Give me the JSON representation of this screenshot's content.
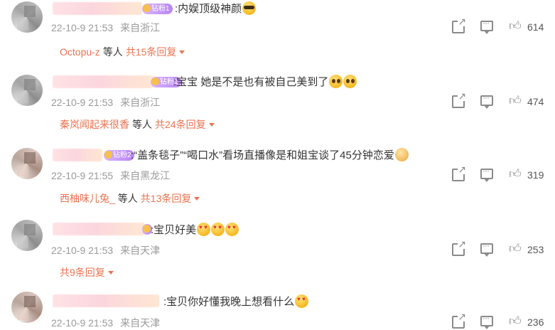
{
  "colors": {
    "accent": "#eb7350",
    "meta": "#9a9a9a",
    "icon": "#8a8a8a"
  },
  "comments": [
    {
      "badge": "钻粉1",
      "text": ":内娱顶级神颜",
      "emojis": [
        "cool-face-emoji"
      ],
      "date": "22-10-9 21:53",
      "location": "来自浙江",
      "likes": "614",
      "reply_name": "Octopu-z",
      "reply_mid": "等人",
      "reply_count": "共15条回复"
    },
    {
      "badge": "钻粉1",
      "text": ":宝宝 她是不是也有被自己美到了",
      "emojis": [
        "pleading-face-emoji",
        "pleading-face-emoji"
      ],
      "date": "22-10-9 21:53",
      "location": "来自浙江",
      "likes": "474",
      "reply_name": "秦岚闻起来很香",
      "reply_mid": "等人",
      "reply_count": "共24条回复"
    },
    {
      "badge": "钻粉2",
      "text": ":“盖条毯子”“喝口水”看场直播像是和姐宝谈了45分钟恋爱",
      "emojis": [
        "shy-face-emoji"
      ],
      "date": "22-10-9 21:55",
      "location": "来自黑龙江",
      "likes": "319",
      "reply_name": "西柚味儿兔_",
      "reply_mid": "等人",
      "reply_count": "共13条回复"
    },
    {
      "badge": "2",
      "text": ":宝贝好美",
      "emojis": [
        "heart-eyes-emoji",
        "heart-eyes-emoji",
        "heart-eyes-emoji"
      ],
      "date": "22-10-9 21:53",
      "location": "来自天津",
      "likes": "253",
      "reply_name": "",
      "reply_mid": "",
      "reply_count": "共9条回复"
    },
    {
      "badge": "",
      "text": ":宝贝你好懂我晚上想看什么",
      "emojis": [
        "heart-eyes-emoji"
      ],
      "date": "22-10-9 21:53",
      "location": "来自天津",
      "likes": "236",
      "reply_name": "",
      "reply_mid": "",
      "reply_count": ""
    }
  ]
}
